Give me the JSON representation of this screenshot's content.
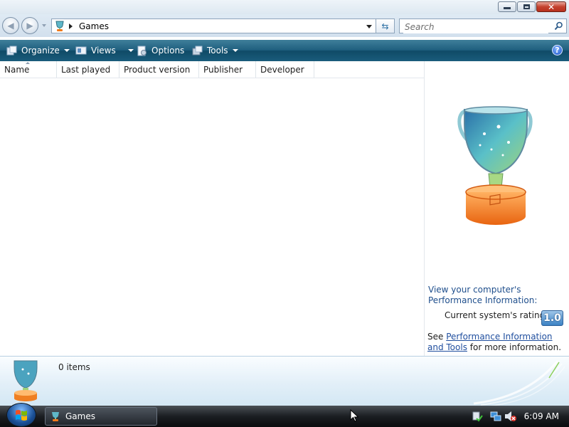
{
  "window": {
    "title": "",
    "controls": [
      "minimize-icon",
      "maximize-icon",
      "close-icon"
    ]
  },
  "address": {
    "location": "Games",
    "search_placeholder": "Search"
  },
  "toolbar": {
    "organize_label": "Organize",
    "views_label": "Views",
    "options_label": "Options",
    "tools_label": "Tools",
    "help_glyph": "?"
  },
  "columns": [
    "Name",
    "Last played",
    "Product version",
    "Publisher",
    "Developer"
  ],
  "preview": {
    "perf_title": "View your computer's Performance Information:",
    "rating_label": "Current system's rating:",
    "rating_value": "1.0",
    "see_prefix": "See",
    "perf_link": "Performance Information and Tools",
    "see_suffix": "for more information."
  },
  "details": {
    "item_count": "0 items"
  },
  "taskbar": {
    "window_button_label": "Games",
    "clock": "6:09 AM"
  },
  "colors": {
    "toolbar": "#1f5f7f",
    "link": "#1f4e9e",
    "trophy_base": "#f07a1c"
  }
}
